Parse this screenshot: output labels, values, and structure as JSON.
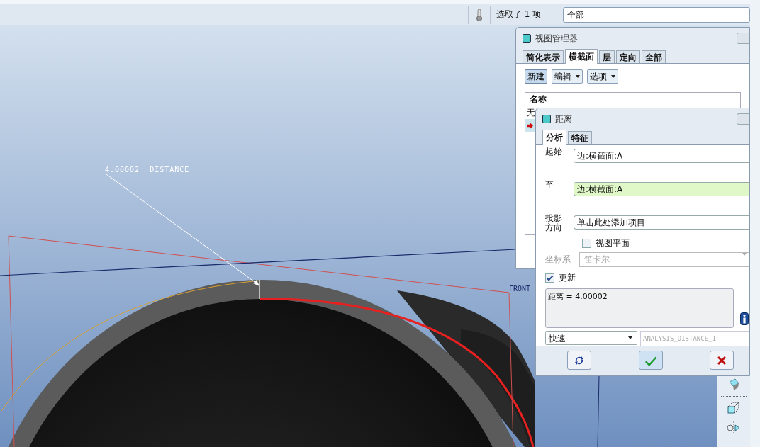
{
  "toolbar": {
    "selection_status": "选取了 1 项",
    "filter": "全部"
  },
  "viewport": {
    "annotation": "4.00002  DISTANCE",
    "datum_label": "FRONT"
  },
  "view_manager": {
    "title": "视图管理器",
    "tabs": [
      {
        "label": "简化表示",
        "selected": false
      },
      {
        "label": "横截面",
        "selected": true
      },
      {
        "label": "层",
        "selected": false
      },
      {
        "label": "定向",
        "selected": false
      },
      {
        "label": "全部",
        "selected": false
      }
    ],
    "buttons": [
      {
        "label": "新建",
        "kind": "button"
      },
      {
        "label": "编辑",
        "kind": "menu"
      },
      {
        "label": "选项",
        "kind": "menu"
      }
    ],
    "list": {
      "column": "名称",
      "rows": [
        {
          "name": "无",
          "marker": false,
          "selected": false
        },
        {
          "marker": true,
          "selected": true
        }
      ]
    }
  },
  "distance_dialog": {
    "title": "距离",
    "tabs": [
      {
        "label": "分析",
        "selected": true
      },
      {
        "label": "特征",
        "selected": false
      }
    ],
    "fields": [
      {
        "label": "起始",
        "value": "边:横截面:A",
        "active": false
      },
      {
        "label": "至",
        "value": "边:横截面:A",
        "active": true
      },
      {
        "label": "投影方向",
        "value": "单击此处添加项目",
        "active": false
      }
    ],
    "view_plane": {
      "label": "视图平面",
      "checked": false
    },
    "coordinate_system": {
      "label": "坐标系",
      "value": "笛卡尔",
      "disabled": true
    },
    "update": {
      "label": "更新",
      "checked": true
    },
    "result": "距离 = 4.00002",
    "mode": "快速",
    "name": "ANALYSIS_DISTANCE_1"
  }
}
